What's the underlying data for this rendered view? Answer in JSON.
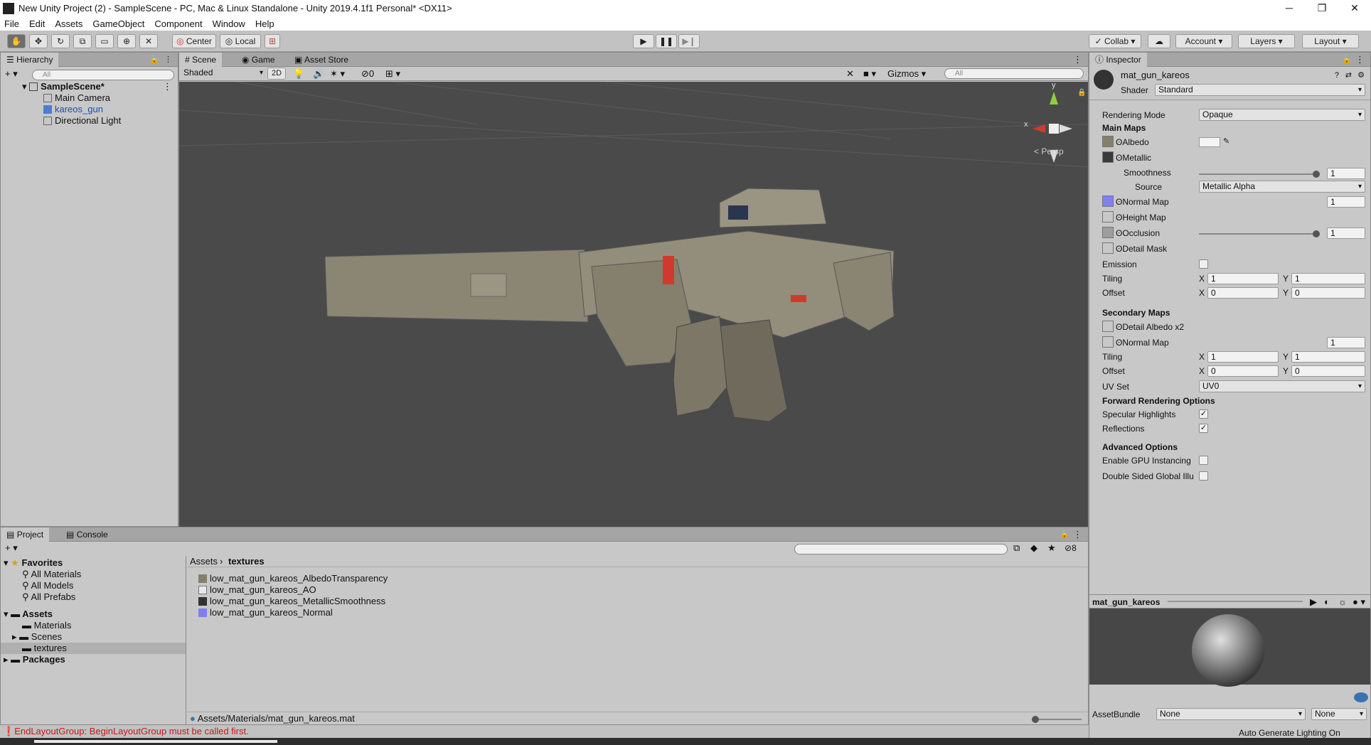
{
  "window": {
    "title": "New Unity Project (2) - SampleScene - PC, Mac & Linux Standalone - Unity 2019.4.1f1 Personal* <DX11>",
    "min": "─",
    "max": "❐",
    "close": "✕"
  },
  "menu": [
    "File",
    "Edit",
    "Assets",
    "GameObject",
    "Component",
    "Window",
    "Help"
  ],
  "toolbar": {
    "center": "Center",
    "local": "Local",
    "collab": "Collab",
    "account": "Account",
    "layers": "Layers",
    "layout": "Layout"
  },
  "hierarchy": {
    "tab": "Hierarchy",
    "search_placeholder": "All",
    "scene": "SampleScene*",
    "items": [
      "Main Camera",
      "kareos_gun",
      "Directional Light"
    ]
  },
  "scene": {
    "tabs": [
      "Scene",
      "Game",
      "Asset Store"
    ],
    "shading": "Shaded",
    "mode2d": "2D",
    "hidden_count": "0",
    "gizmos": "Gizmos",
    "search_placeholder": "All",
    "persp": "Persp",
    "axis_x": "x",
    "axis_y": "y"
  },
  "inspector": {
    "tab": "Inspector",
    "material_name": "mat_gun_kareos",
    "shader_label": "Shader",
    "shader_value": "Standard",
    "rendering_mode_label": "Rendering Mode",
    "rendering_mode_value": "Opaque",
    "main_maps": "Main Maps",
    "albedo": "Albedo",
    "metallic": "Metallic",
    "smoothness": "Smoothness",
    "smoothness_value": "1",
    "smoothness_level": 1.0,
    "source": "Source",
    "source_value": "Metallic Alpha",
    "normal_map": "Normal Map",
    "normal_value": "1",
    "height_map": "Height Map",
    "occlusion": "Occlusion",
    "occlusion_value": "1",
    "occlusion_level": 1.0,
    "detail_mask": "Detail Mask",
    "emission": "Emission",
    "tiling": "Tiling",
    "offset": "Offset",
    "x": "X",
    "y": "Y",
    "tiling_x": "1",
    "tiling_y": "1",
    "offset_x": "0",
    "offset_y": "0",
    "secondary_maps": "Secondary Maps",
    "detail_albedo": "Detail Albedo x2",
    "sec_normal_map": "Normal Map",
    "sec_normal_value": "1",
    "sec_tiling_x": "1",
    "sec_tiling_y": "1",
    "sec_offset_x": "0",
    "sec_offset_y": "0",
    "uv_set": "UV Set",
    "uv_set_value": "UV0",
    "forward_opts": "Forward Rendering Options",
    "specular": "Specular Highlights",
    "reflections": "Reflections",
    "advanced": "Advanced Options",
    "gpu_instancing": "Enable GPU Instancing",
    "double_sided": "Double Sided Global Illu",
    "check": "✓",
    "preview_name": "mat_gun_kareos",
    "assetbundle_label": "AssetBundle",
    "assetbundle_value": "None",
    "assetbundle_variant": "None"
  },
  "project": {
    "tabs": [
      "Project",
      "Console"
    ],
    "favorites": "Favorites",
    "fav_items": [
      "All Materials",
      "All Models",
      "All Prefabs"
    ],
    "assets": "Assets",
    "asset_folders": [
      "Materials",
      "Scenes",
      "textures"
    ],
    "packages": "Packages",
    "breadcrumb": [
      "Assets",
      "textures"
    ],
    "files": [
      "low_mat_gun_kareos_AlbedoTransparency",
      "low_mat_gun_kareos_AO",
      "low_mat_gun_kareos_MetallicSmoothness",
      "low_mat_gun_kareos_Normal"
    ],
    "path": "Assets/Materials/mat_gun_kareos.mat",
    "hidden_count": "8"
  },
  "status": {
    "error": "EndLayoutGroup: BeginLayoutGroup must be called first.",
    "lighting": "Auto Generate Lighting On"
  }
}
